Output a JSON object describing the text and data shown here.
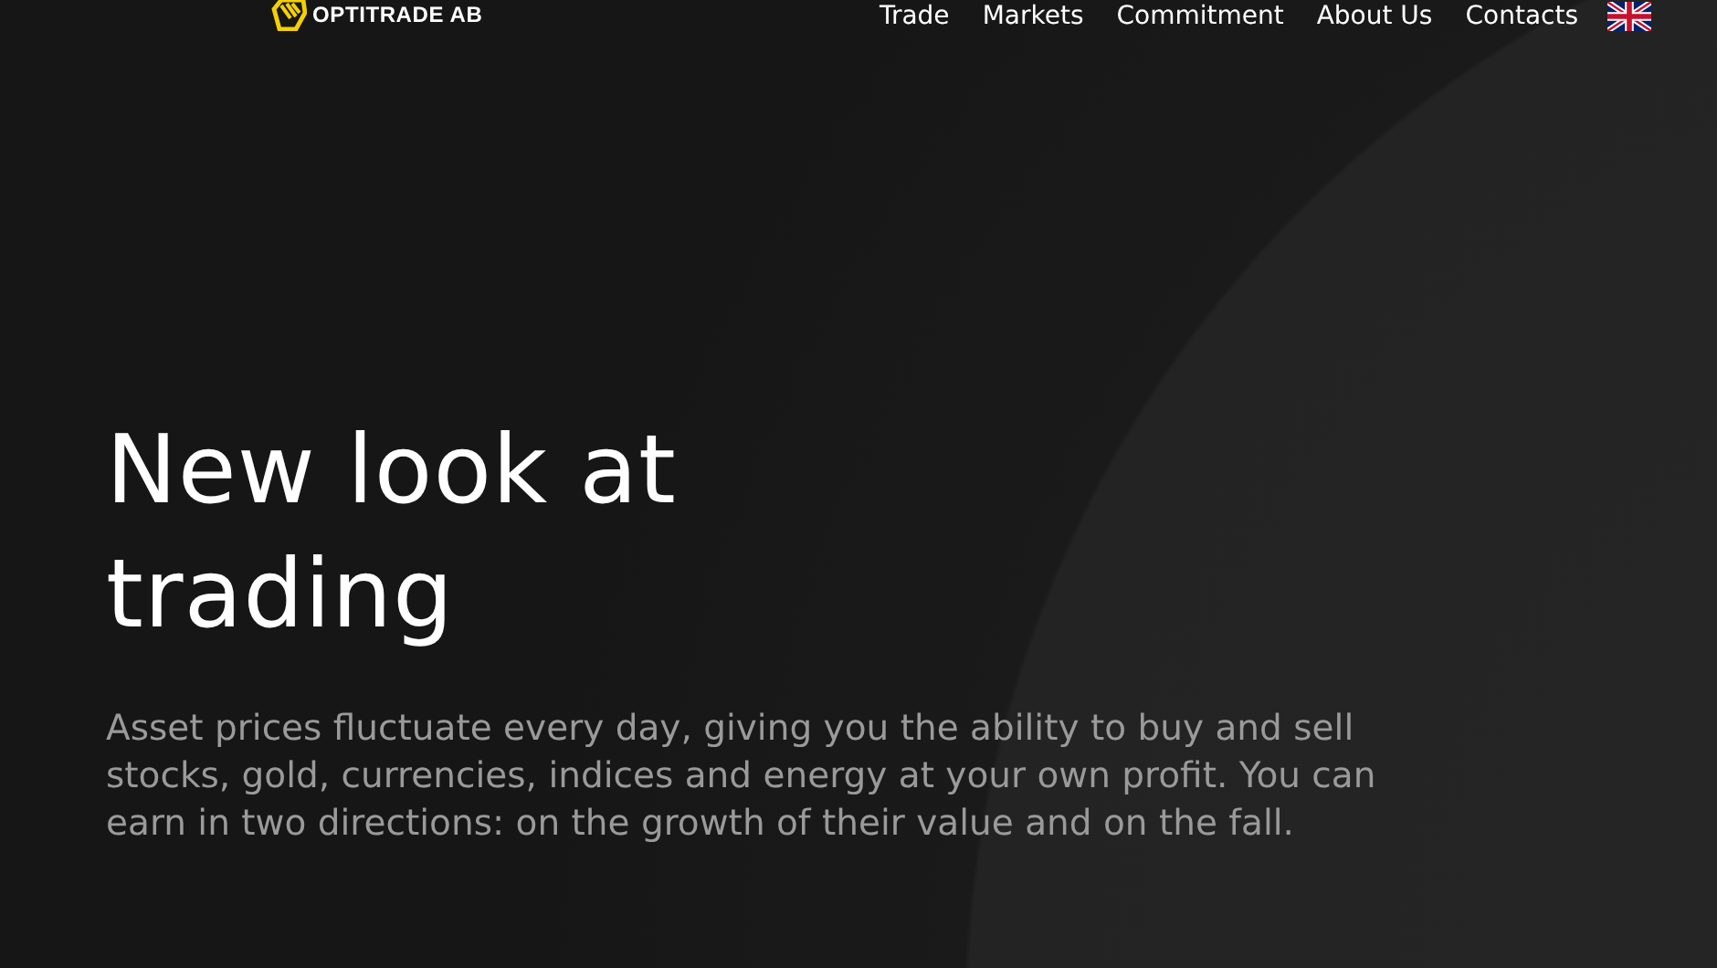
{
  "header": {
    "logo_text": "OPTITRADE AB",
    "nav": [
      {
        "label": "Trade"
      },
      {
        "label": "Markets"
      },
      {
        "label": "Commitment"
      },
      {
        "label": "About Us"
      },
      {
        "label": "Contacts"
      }
    ]
  },
  "hero": {
    "title": "New look at trading",
    "text": "Asset prices fluctuate every day, giving you the ability to buy and sell stocks, gold, currencies, indices and energy at your own profit. You can earn in two directions: on the growth of their value and on the fall."
  }
}
